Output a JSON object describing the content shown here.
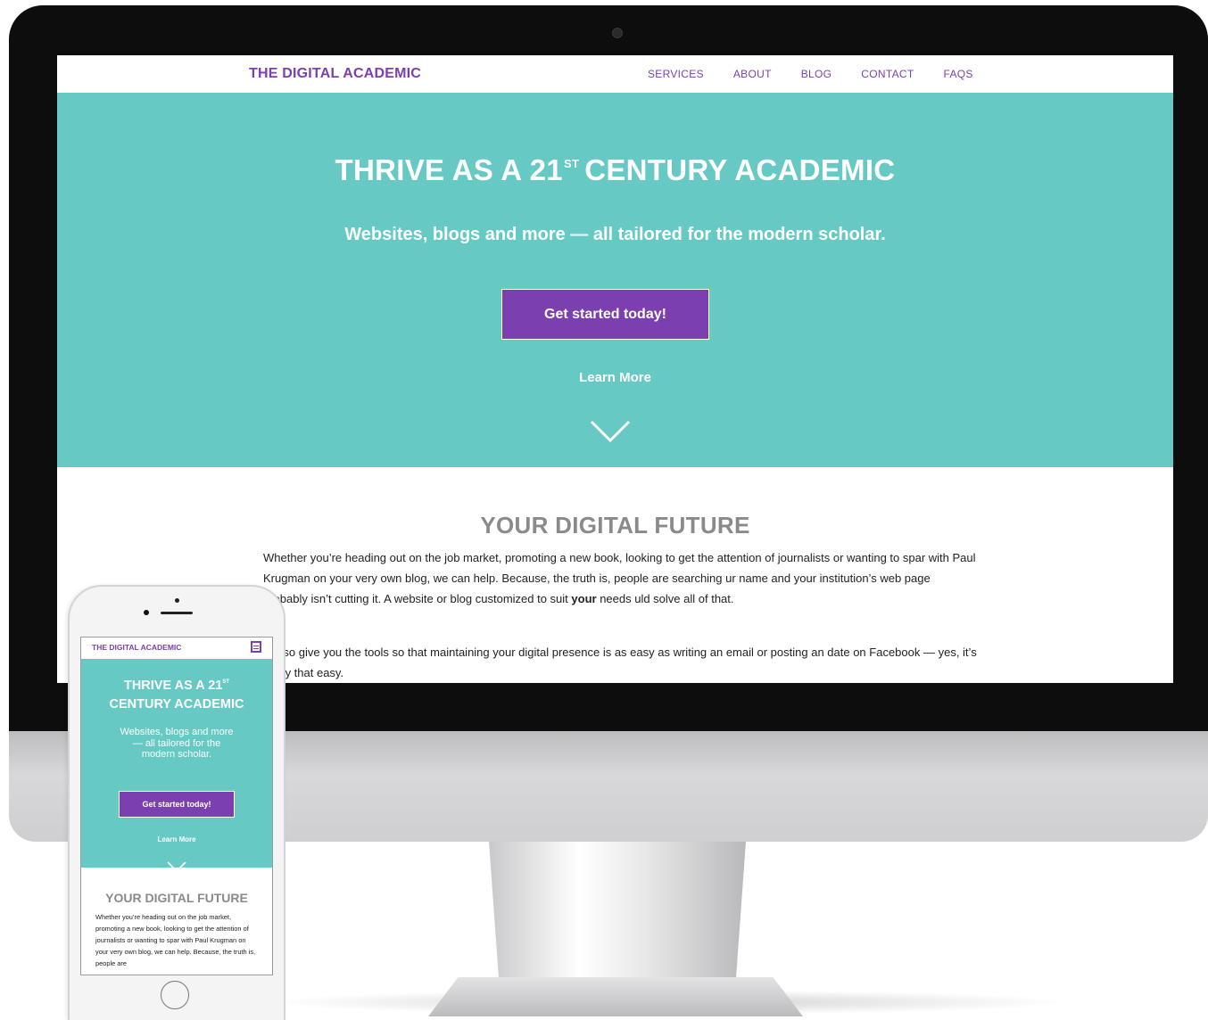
{
  "brand": {
    "purple": "#7b3fb0",
    "teal": "#66c9c4",
    "heading_gray": "#8a8a8a"
  },
  "desktop": {
    "logo": "THE DIGITAL ACADEMIC",
    "nav": [
      "SERVICES",
      "ABOUT",
      "BLOG",
      "CONTACT",
      "FAQS"
    ],
    "hero": {
      "title_pre": "THRIVE AS A 21",
      "title_sup": "ST",
      "title_post": "CENTURY ACADEMIC",
      "subtitle": "Websites, blogs and more — all tailored for the modern scholar.",
      "cta": "Get started today!",
      "learn_more": "Learn More",
      "chevron_icon": "chevron-down-icon"
    },
    "section": {
      "title": "YOUR DIGITAL FUTURE",
      "p1_a": "Whether you’re heading out on the job market, promoting a new book, looking to get the attention of journalists or wanting to spar with Paul Krugman on your very own blog, we can help. Because, the truth is, people are searching ur name and your institution’s web page probably isn’t cutting it. A website or blog customized to suit ",
      "p1_bold": "your",
      "p1_b": " needs uld solve all of that.",
      "p2": "’ll also give you the tools so that maintaining your digital presence is as easy as writing an email or posting an date on Facebook — yes, it’s really that easy."
    }
  },
  "mobile": {
    "logo": "THE DIGITAL ACADEMIC",
    "menu_icon": "hamburger-menu-icon",
    "hero": {
      "title_pre": "THRIVE AS A 21",
      "title_sup": "ST",
      "title_post": "CENTURY ACADEMIC",
      "subtitle": "Websites, blogs and more — all tailored for the modern scholar.",
      "cta": "Get started today!",
      "learn_more": "Learn More"
    },
    "section": {
      "title": "YOUR DIGITAL FUTURE",
      "p1": "Whether you’re heading out on the job market, promoting a new book, looking to get the attention of journalists or wanting to spar with Paul Krugman on your very own blog, we can help. Because, the truth is, people are"
    }
  }
}
